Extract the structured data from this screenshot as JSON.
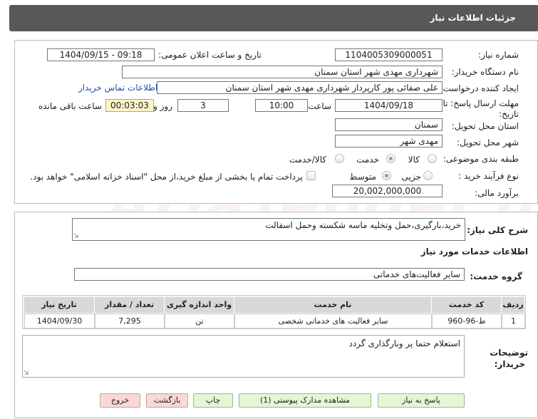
{
  "panel_title": "جزئیات اطلاعات نیاز",
  "need_number": {
    "label": "شماره نیاز:",
    "value": "1104005309000051"
  },
  "announce": {
    "label": "تاریخ و ساعت اعلان عمومی:",
    "value": "1404/09/15 - 09:18"
  },
  "buyer_org": {
    "label": "نام دستگاه خریدار:",
    "value": "شهرداری مهدی شهر استان سمنان"
  },
  "requester": {
    "label": "ایجاد کننده درخواست:",
    "value": "علی صفائی پور کارپرداز شهرداری مهدی شهر استان سمنان",
    "contact_link": "اطلاعات تماس خریدار"
  },
  "deadline": {
    "label_1": "مهلت ارسال پاسخ: تا",
    "label_2": "تاریخ:",
    "date": "1404/09/18",
    "time_label": "ساعت",
    "time": "10:00",
    "days": "3",
    "days_label": "روز و",
    "remaining": "00:03:03",
    "remaining_label": "ساعت باقی مانده"
  },
  "province": {
    "label": "استان محل تحویل:",
    "value": "سمنان"
  },
  "city": {
    "label": "شهر محل تحویل:",
    "value": "مهدی شهر"
  },
  "category": {
    "label": "طبقه بندی موضوعی:",
    "options": [
      "کالا",
      "خدمت",
      "کالا/خدمت"
    ],
    "selected": "خدمت"
  },
  "process": {
    "label": "نوع فرآیند خرید :",
    "options": [
      "جزیی",
      "متوسط"
    ],
    "selected": "متوسط",
    "payment_note": "پرداخت تمام یا بخشی از مبلغ خرید،از محل \"اسناد خزانه اسلامی\" خواهد بود."
  },
  "budget": {
    "label": "برآورد مالی:",
    "value": "20,002,000,000"
  },
  "summary": {
    "label": "شرح کلی نیاز:",
    "value": "خرید،بارگیری،حمل وتخلیه ماسه شکسته وحمل اسفالت"
  },
  "services_info": {
    "title": "اطلاعات خدمات مورد نیاز"
  },
  "service_group": {
    "label": "گروه خدمت:",
    "value": "سایر فعالیت‌های خدماتی"
  },
  "table": {
    "headers": [
      "ردیف",
      "کد خدمت",
      "نام خدمت",
      "واحد اندازه گیری",
      "تعداد / مقدار",
      "تاریخ نیاز"
    ],
    "rows": [
      [
        "1",
        "ط-96-960",
        "سایر فعالیت های خدماتی شخصی",
        "تن",
        "7,295",
        "1404/09/30"
      ]
    ]
  },
  "buyer_notes": {
    "label_1": "توضیحات",
    "label_2": "خریدار:",
    "value": "استعلام حتما پر وبارگذاری گردد"
  },
  "buttons": {
    "reply": "پاسخ به نیاز",
    "attachments": "مشاهده مدارک پیوستی (1)",
    "print": "چاپ",
    "back": "بازگشت",
    "exit": "خروج"
  },
  "colors": {
    "header_bg": "#585858",
    "button_green": "#e6f5d6",
    "button_pink": "#f8d8d8",
    "link": "#1a4fb5"
  }
}
